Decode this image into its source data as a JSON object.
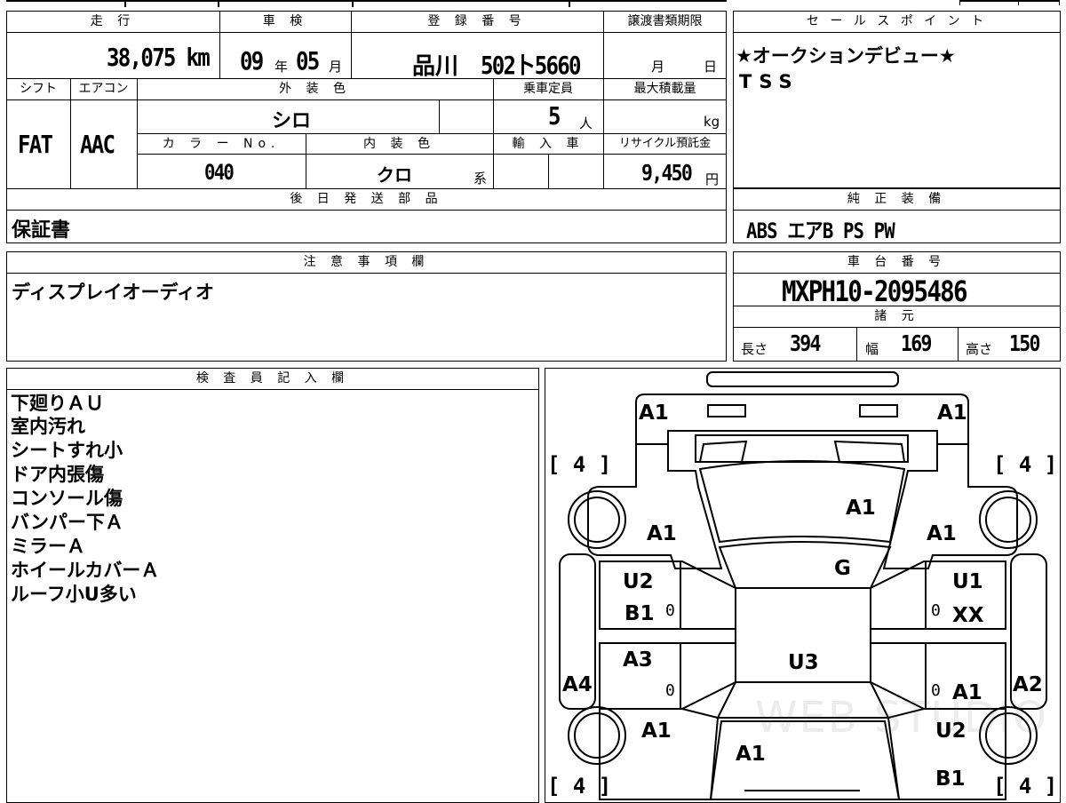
{
  "header_top": {
    "mileage_label": "走 行",
    "mileage": "38,075 km",
    "inspection_label": "車 検",
    "inspection_year": "09",
    "inspection_year_unit": "年",
    "inspection_month": "05",
    "inspection_month_unit": "月",
    "registration_label": "登 録 番 号",
    "registration_area": "品川",
    "registration_number": "502ト5660",
    "transfer_deadline_label": "譲渡書類期限",
    "transfer_month_unit": "月",
    "transfer_day_unit": "日"
  },
  "row2": {
    "shift_label": "シフト",
    "shift": "FAT",
    "aircon_label": "エアコン",
    "aircon": "AAC",
    "exterior_color_label": "外 装 色",
    "exterior_color": "シロ",
    "capacity_label": "乗車定員",
    "capacity": "5",
    "capacity_unit": "人",
    "max_load_label": "最大積載量",
    "max_load_unit": "kg",
    "color_no_label": "カ ラ ー No.",
    "color_no": "040",
    "interior_color_label": "内 装 色",
    "interior_color": "クロ",
    "interior_color_suffix": "系",
    "import_label": "輸 入 車",
    "recycle_label": "リサイクル預託金",
    "recycle_fee": "9,450",
    "recycle_unit": "円"
  },
  "later_parts": {
    "label": "後 日 発 送 部 品",
    "value": "保証書"
  },
  "sales_point": {
    "label": "セ ー ル ス ポ イ ン ト",
    "lines": [
      "★オークションデビュー★",
      "TSS"
    ]
  },
  "equipment": {
    "label": "純 正 装 備",
    "value": "ABS エアB PS PW"
  },
  "notes": {
    "label": "注 意 事 項 欄",
    "value": "ディスプレイオーディオ"
  },
  "chassis": {
    "label": "車 台 番 号",
    "value": "MXPH10-2095486",
    "dims_label": "諸 元",
    "length_label": "長さ",
    "length": "394",
    "width_label": "幅",
    "width": "169",
    "height_label": "高さ",
    "height": "150"
  },
  "inspector": {
    "label": "検 査 員 記 入 欄",
    "lines": [
      "下廻りＡＵ",
      "室内汚れ",
      "シートすれ小",
      "ドア内張傷",
      "コンソール傷",
      "バンパー下Ａ",
      "ミラーＡ",
      "ホイールカバーＡ",
      "ルーフ小U多い"
    ]
  },
  "diagram": {
    "tire_labels": [
      "[ 4 ]",
      "[ 4 ]",
      "[ 4 ]",
      "[ 4 ]"
    ],
    "marks": {
      "front_left_corner": "A1",
      "front_right_corner": "A1",
      "hood": "A1",
      "left_front_fender": "A1",
      "right_front_fender": "A1",
      "windshield": "G",
      "left_front_door_1": "U2",
      "left_front_door_2": "B1",
      "right_front_door_1": "U1",
      "right_front_door_2": "XX",
      "left_rear_door": "A3",
      "right_rear_door": "A1",
      "roof": "U3",
      "left_sill": "A4",
      "right_sill": "A2",
      "left_rear_fender": "A1",
      "right_rear_fender_1": "U2",
      "right_rear_fender_2": "B1",
      "trunk": "A1"
    },
    "zeros": [
      "0",
      "0",
      "0",
      "0"
    ],
    "watermark": "WEB STUDIO"
  }
}
